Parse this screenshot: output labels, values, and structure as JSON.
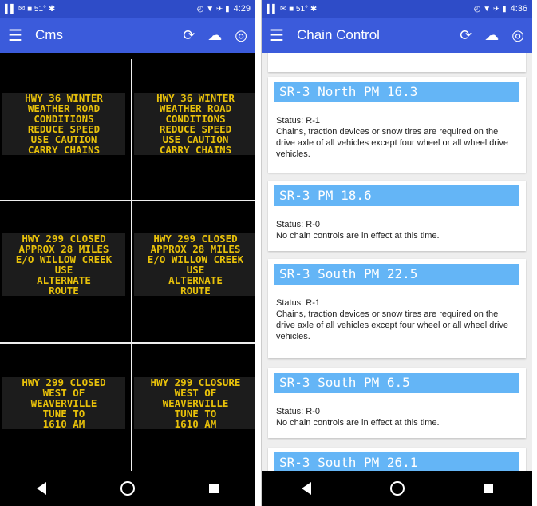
{
  "left": {
    "status": {
      "time": "4:29",
      "left_glyphs": "▌▌ ✉ ■ 51° ✱",
      "right_glyphs": "◴ ▼ ✈ ▮"
    },
    "appbar": {
      "title": "Cms",
      "menu_icon": "menu-icon",
      "refresh_icon": "refresh-icon",
      "cloud_icon": "cloud-download-icon",
      "settings_icon": "settings-icon"
    },
    "signs": [
      {
        "lines": [
          "HWY 36 WINTER",
          "WEATHER ROAD",
          "CONDITIONS",
          "REDUCE SPEED",
          "USE CAUTION",
          "CARRY CHAINS"
        ]
      },
      {
        "lines": [
          "HWY 36 WINTER",
          "WEATHER ROAD",
          "CONDITIONS",
          "REDUCE SPEED",
          "USE CAUTION",
          "CARRY CHAINS"
        ]
      },
      {
        "lines": [
          "HWY 299 CLOSED",
          "APPROX 28 MILES",
          "E/O WILLOW CREEK",
          "USE",
          "ALTERNATE",
          "ROUTE"
        ]
      },
      {
        "lines": [
          "HWY 299 CLOSED",
          "APPROX 28 MILES",
          "E/O WILLOW CREEK",
          "USE",
          "ALTERNATE",
          "ROUTE"
        ]
      },
      {
        "lines": [
          "HWY 299 CLOSED",
          "WEST OF",
          "WEAVERVILLE",
          "TUNE TO",
          "1610  AM"
        ]
      },
      {
        "lines": [
          "HWY 299 CLOSURE",
          "WEST OF",
          "WEAVERVILLE",
          "TUNE TO",
          "1610  AM"
        ]
      }
    ]
  },
  "right": {
    "status": {
      "time": "4:36",
      "left_glyphs": "▌▌ ✉ ■ 51° ✱",
      "right_glyphs": "◴ ▼ ✈ ▮"
    },
    "appbar": {
      "title": "Chain Control"
    },
    "cards": [
      {
        "title": "SR-3 North PM 16.3",
        "status": "Status: R-1",
        "desc": "Chains, traction devices or snow tires are required on the drive axle of all vehicles except four wheel or all wheel drive vehicles."
      },
      {
        "title": "SR-3 PM 18.6",
        "status": "Status: R-0",
        "desc": "No chain controls are in effect at this time."
      },
      {
        "title": "SR-3 South PM 22.5",
        "status": "Status: R-1",
        "desc": "Chains, traction devices or snow tires are required on the drive axle of all vehicles except four wheel or all wheel drive vehicles."
      },
      {
        "title": "SR-3 South PM 6.5",
        "status": "Status: R-0",
        "desc": "No chain controls are in effect at this time."
      },
      {
        "title": "SR-3 South PM 26.1",
        "status": "",
        "desc": ""
      }
    ]
  }
}
